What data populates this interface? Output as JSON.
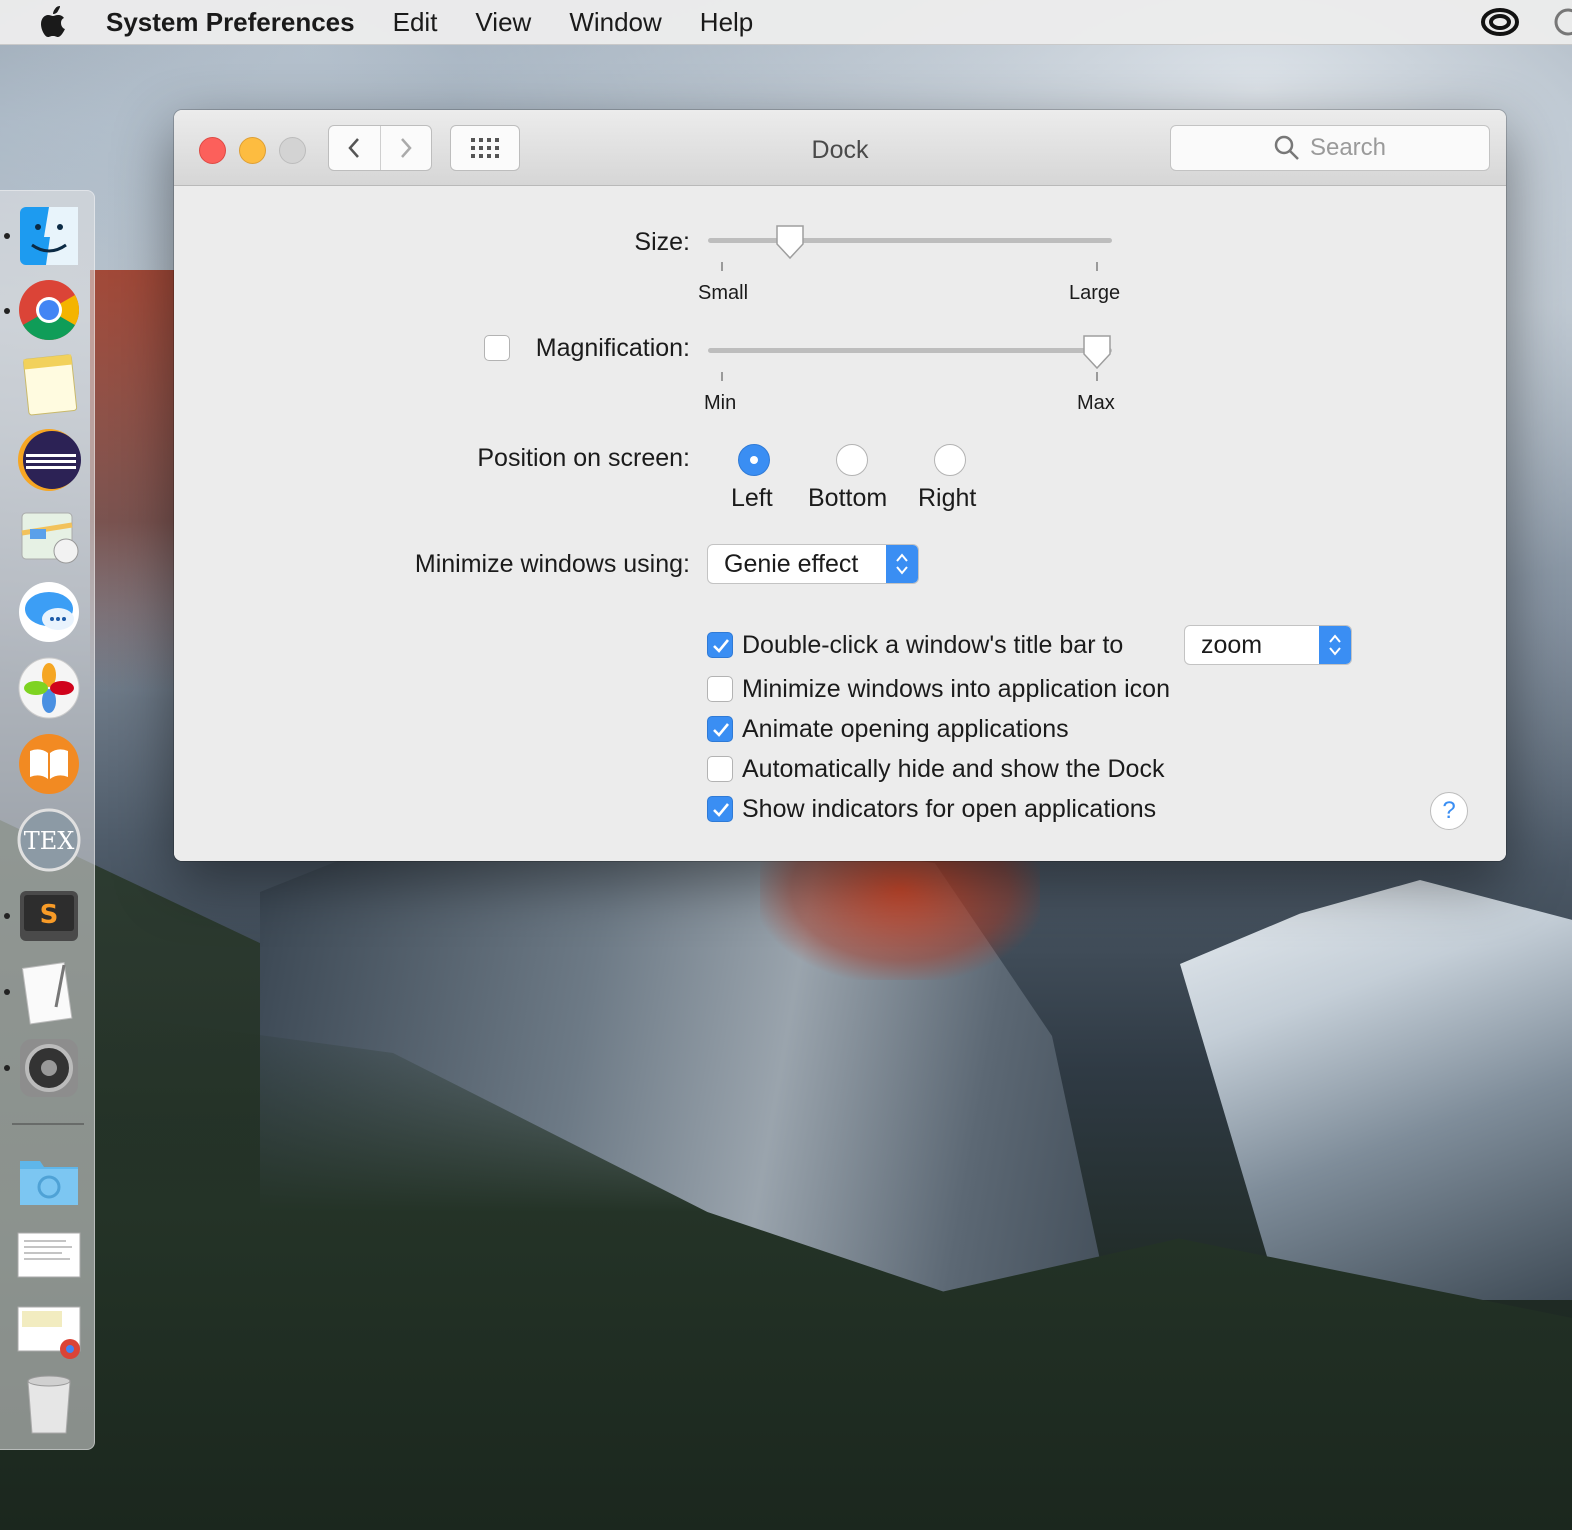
{
  "menubar": {
    "app_name": "System Preferences",
    "items": [
      "Edit",
      "View",
      "Window",
      "Help"
    ],
    "right_icons": [
      "creative-cloud-icon",
      "sync-icon"
    ]
  },
  "window": {
    "title": "Dock",
    "search_placeholder": "Search"
  },
  "size": {
    "label": "Size:",
    "min_label": "Small",
    "max_label": "Large",
    "value_fraction": 0.2
  },
  "magnification": {
    "label": "Magnification:",
    "checked": false,
    "min_label": "Min",
    "max_label": "Max",
    "value_fraction": 1.0
  },
  "position": {
    "label": "Position on screen:",
    "options": [
      "Left",
      "Bottom",
      "Right"
    ],
    "selected": "Left"
  },
  "minimize": {
    "label": "Minimize windows using:",
    "value": "Genie effect"
  },
  "options": [
    {
      "label": "Double-click a window's title bar to",
      "checked": true
    },
    {
      "label": "Minimize windows into application icon",
      "checked": false
    },
    {
      "label": "Animate opening applications",
      "checked": true
    },
    {
      "label": "Automatically hide and show the Dock",
      "checked": false
    },
    {
      "label": "Show indicators for open applications",
      "checked": true
    }
  ],
  "double_click_action": "zoom",
  "help_label": "?",
  "dock": {
    "apps": [
      "finder-icon",
      "chrome-icon",
      "notes-icon",
      "eclipse-icon",
      "maps-icon",
      "messages-icon",
      "photos-icon",
      "ibooks-icon",
      "tex-icon",
      "sublime-text-icon",
      "textedit-icon",
      "system-preferences-icon",
      "downloads-folder-icon",
      "document-thumbnail-icon",
      "chrome-document-icon",
      "trash-icon"
    ]
  },
  "colors": {
    "accent": "#3a8ef3",
    "close": "#fc605b",
    "minimize": "#fdbc40"
  }
}
